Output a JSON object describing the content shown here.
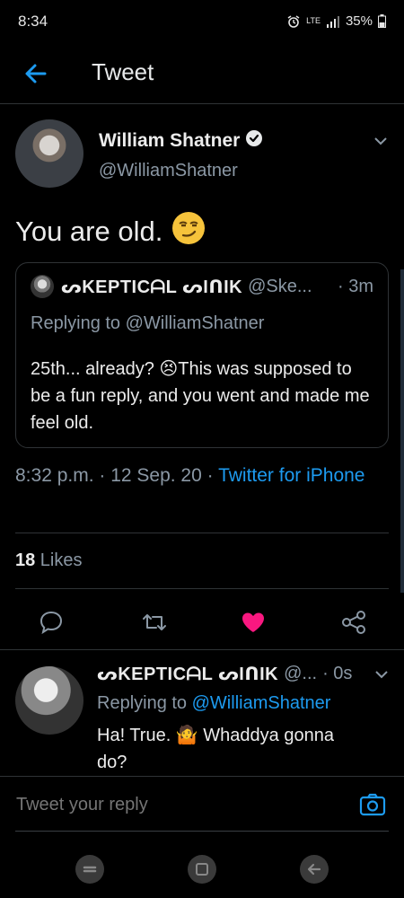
{
  "status_bar": {
    "time": "8:34",
    "network": "LTE",
    "battery": "35%"
  },
  "header": {
    "title": "Tweet"
  },
  "tweet": {
    "author_name": "William Shatner",
    "author_handle": "@WilliamShatner",
    "text": "You are old.",
    "quote": {
      "author_name": "ᔕKEPTICᗩL ᔕIᑎIK",
      "author_handle": "@Ske...",
      "time": "· 3m",
      "replying_to": "Replying to @WilliamShatner",
      "body": "25th... already? 😣This was supposed to be a fun reply, and you went and made me feel old."
    },
    "timestamp": "8:32 p.m. · 12 Sep. 20 · ",
    "source": "Twitter for iPhone",
    "likes_count": "18",
    "likes_label": " Likes"
  },
  "reply": {
    "author_name": "ᔕKEPTICᗩL ᔕIᑎIK",
    "author_handle": "@...",
    "time": "· 0s",
    "replying_label": "Replying to ",
    "replying_handle": "@WilliamShatner",
    "body": "Ha! True. 🤷 Whaddya gonna do?"
  },
  "compose": {
    "placeholder": "Tweet your reply"
  },
  "colors": {
    "accent": "#1d9bf0",
    "like_red": "#f91880",
    "background": "#000000"
  }
}
